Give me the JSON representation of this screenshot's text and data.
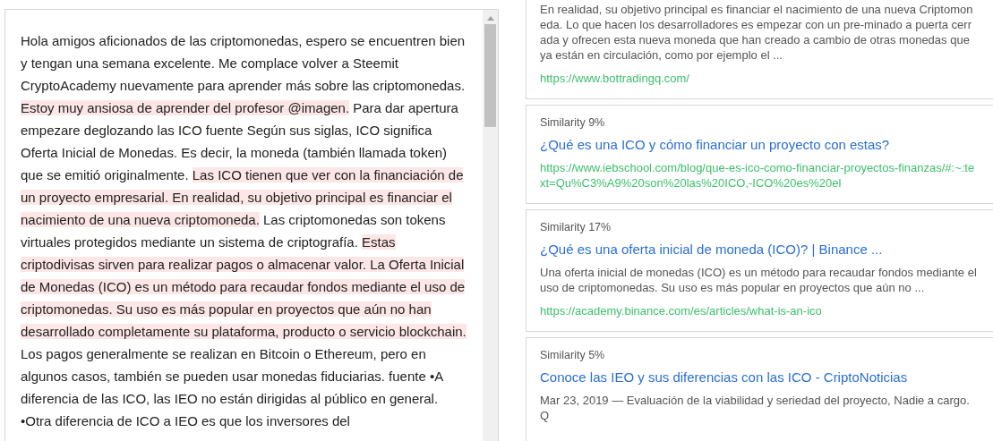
{
  "essay": {
    "segments": [
      {
        "text": "Hola amigos aficionados de las criptomonedas, espero se encuentren bien y tengan una semana excelente. Me complace volver a Steemit CryptoAcademy nuevamente para aprender más sobre las criptomonedas. ",
        "highlighted": false
      },
      {
        "text": "Estoy muy ansiosa de aprender del profesor @imagen.",
        "highlighted": true
      },
      {
        "text": " Para dar apertura empezare deglozando las ICO fuente Según sus siglas, ICO significa Oferta Inicial de Monedas. Es decir, la moneda (también llamada token) que se emitió originalmente. ",
        "highlighted": false
      },
      {
        "text": "Las ICO tienen que ver con la financiación de un proyecto empresarial. ",
        "highlighted": true
      },
      {
        "text": "En realidad, su objetivo principal es financiar el nacimiento de una nueva criptomoneda.",
        "highlighted": true
      },
      {
        "text": " Las criptomonedas son tokens virtuales protegidos mediante un sistema de criptografía. ",
        "highlighted": false
      },
      {
        "text": "Estas criptodivisas sirven para realizar pagos o almacenar valor. ",
        "highlighted": true
      },
      {
        "text": "La Oferta Inicial de Monedas (ICO) es un método para recaudar fondos mediante el uso de criptomonedas. ",
        "highlighted": true
      },
      {
        "text": "Su uso es más popular en proyectos que aún no han desarrollado completamente su plataforma, producto o servicio blockchain.",
        "highlighted": true
      },
      {
        "text": " Los pagos generalmente se realizan en Bitcoin o Ethereum, pero en algunos casos, también se pueden usar monedas fiduciarias. fuente •A diferencia de las ICO, las IEO no están dirigidas al público en general. •Otra diferencia de ICO a IEO es que los inversores del",
        "highlighted": false
      }
    ]
  },
  "results": [
    {
      "snippet": "En realidad, su objetivo principal es financiar el nacimiento de una nueva Criptomoneda. Lo que hacen los desarrolladores es empezar con un pre-minado a puerta cerrada y ofrecen esta nueva moneda que han creado a cambio de otras monedas que ya están en circulación, como por ejemplo el ...",
      "url": "https://www.bottradingq.com/"
    },
    {
      "similarity": "Similarity 9%",
      "title": "¿Qué es una ICO y cómo financiar un proyecto con estas?",
      "url": "https://www.iebschool.com/blog/que-es-ico-como-financiar-proyectos-finanzas/#:~:text=Qu%C3%A9%20son%20las%20ICO,-ICO%20es%20el"
    },
    {
      "similarity": "Similarity 17%",
      "title": "¿Qué es una oferta inicial de moneda (ICO)? | Binance ...",
      "snippet": "Una oferta inicial de monedas (ICO) es un método para recaudar fondos mediante el uso de criptomonedas. Su uso es más popular en proyectos que aún no ...",
      "url": "https://academy.binance.com/es/articles/what-is-an-ico"
    },
    {
      "similarity": "Similarity 5%",
      "title": "Conoce las IEO y sus diferencias con las ICO - CriptoNoticias",
      "snippet": "Mar 23, 2019 — Evaluación de la viabilidad y seriedad del proyecto, Nadie a cargo. Q"
    }
  ]
}
